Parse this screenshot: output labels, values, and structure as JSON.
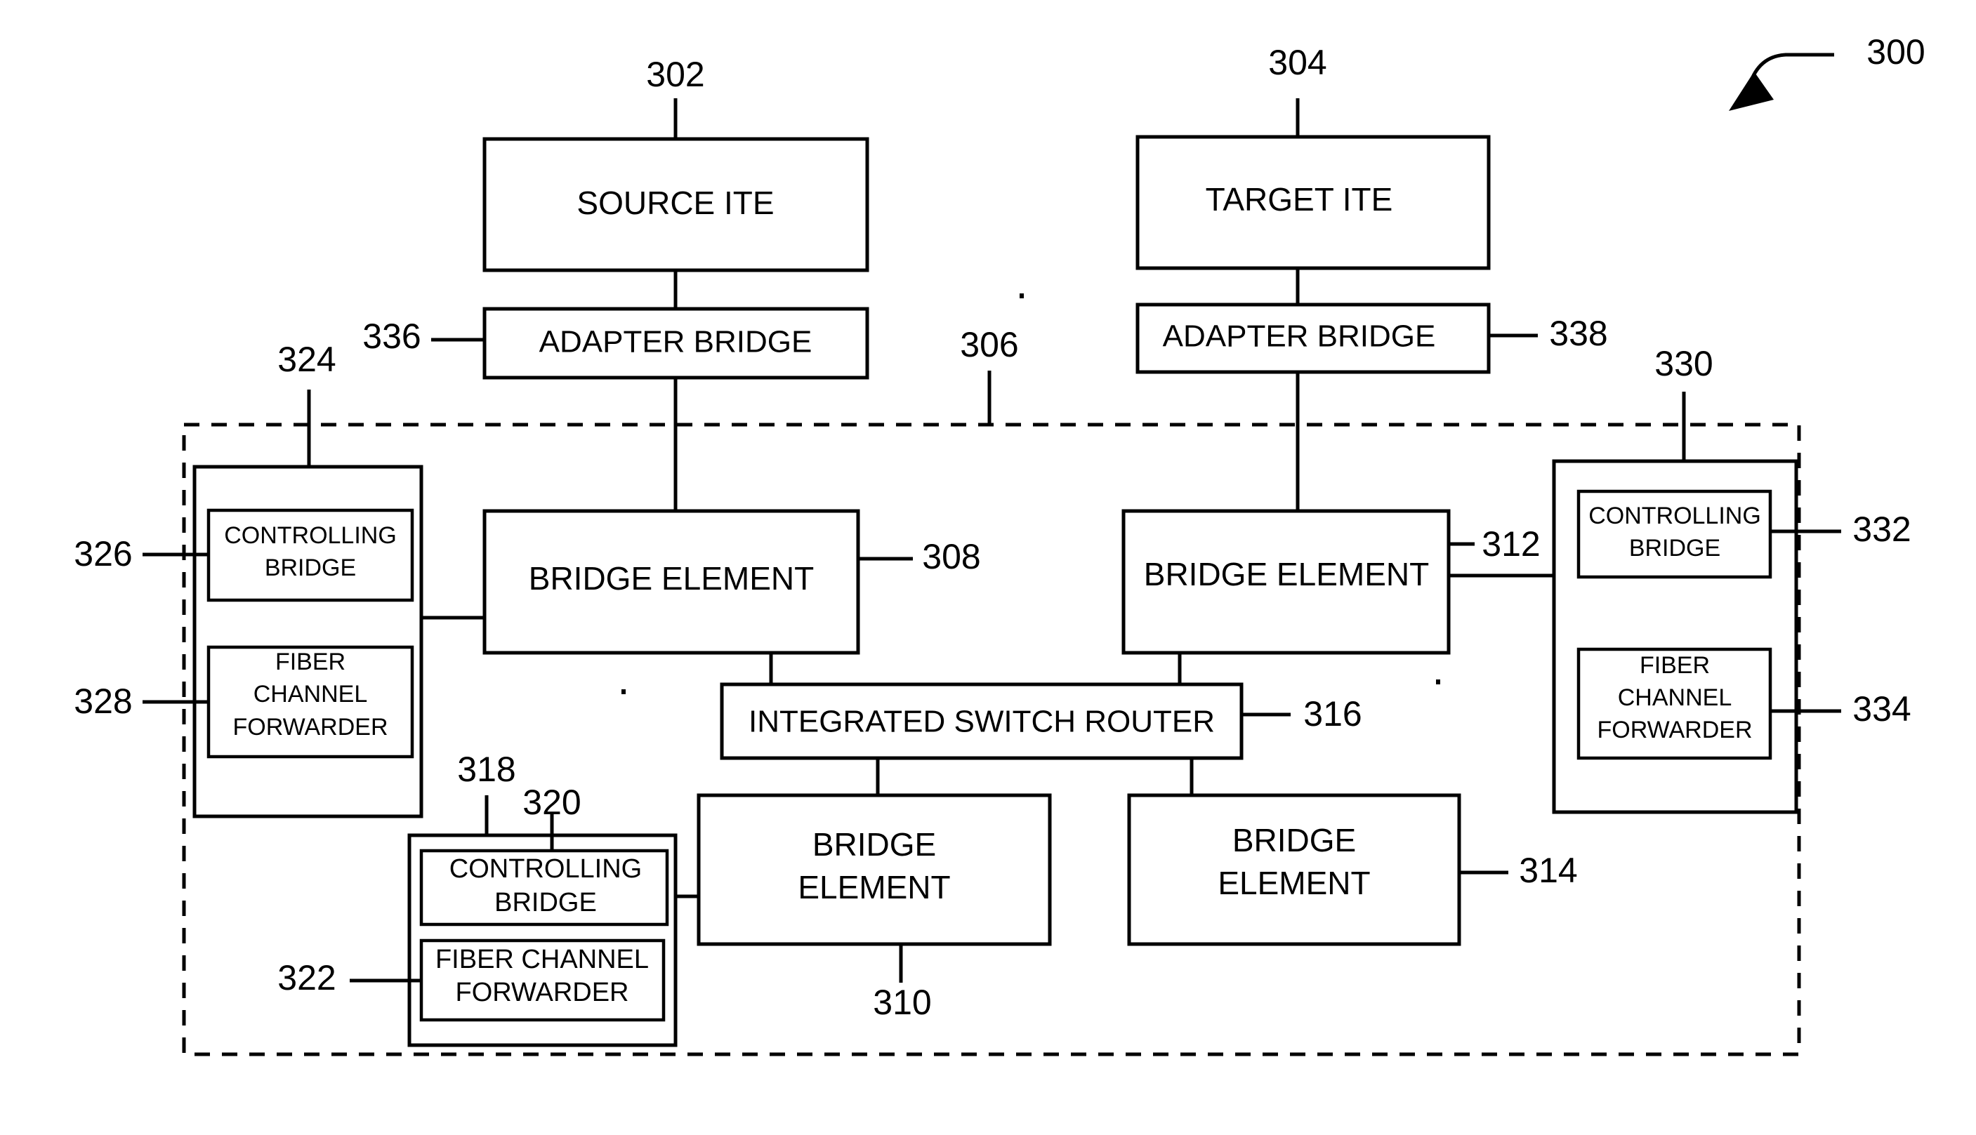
{
  "figure": {
    "figure_number": "300",
    "boxes": {
      "source_ite": "SOURCE ITE",
      "target_ite": "TARGET ITE",
      "adapter_bridge_left": "ADAPTER BRIDGE",
      "adapter_bridge_right": "ADAPTER BRIDGE",
      "bridge_element_308": "BRIDGE ELEMENT",
      "bridge_element_312": "BRIDGE ELEMENT",
      "integrated_switch_router": "INTEGRATED SWITCH ROUTER",
      "bridge_element_310_line1": "BRIDGE",
      "bridge_element_310_line2": "ELEMENT",
      "bridge_element_314_line1": "BRIDGE",
      "bridge_element_314_line2": "ELEMENT",
      "controlling_bridge_326_line1": "CONTROLLING",
      "controlling_bridge_326_line2": "BRIDGE",
      "fiber_channel_forwarder_328_line1": "FIBER",
      "fiber_channel_forwarder_328_line2": "CHANNEL",
      "fiber_channel_forwarder_328_line3": "FORWARDER",
      "controlling_bridge_332_line1": "CONTROLLING",
      "controlling_bridge_332_line2": "BRIDGE",
      "fiber_channel_forwarder_334_line1": "FIBER",
      "fiber_channel_forwarder_334_line2": "CHANNEL",
      "fiber_channel_forwarder_334_line3": "FORWARDER",
      "controlling_bridge_320_line1": "CONTROLLING",
      "controlling_bridge_320_line2": "BRIDGE",
      "fiber_channel_forwarder_322_line1": "FIBER CHANNEL",
      "fiber_channel_forwarder_322_line2": "FORWARDER"
    },
    "reference_numerals": {
      "n300": "300",
      "n302": "302",
      "n304": "304",
      "n306": "306",
      "n308": "308",
      "n310": "310",
      "n312": "312",
      "n314": "314",
      "n316": "316",
      "n318": "318",
      "n320": "320",
      "n322": "322",
      "n324": "324",
      "n326": "326",
      "n328": "328",
      "n330": "330",
      "n332": "332",
      "n334": "334",
      "n336": "336",
      "n338": "338"
    }
  }
}
